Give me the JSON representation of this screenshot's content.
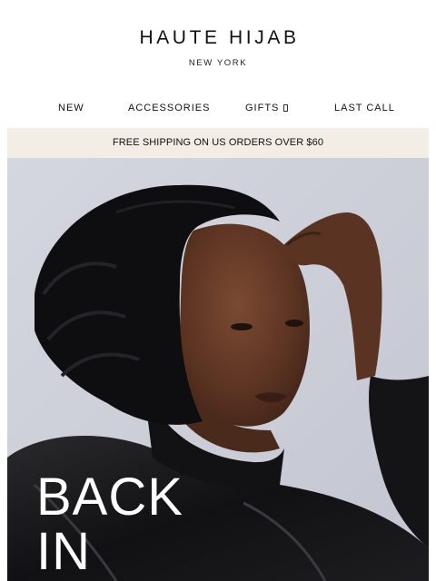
{
  "brand": {
    "name": "HAUTE HIJAB",
    "location": "NEW YORK"
  },
  "nav": {
    "items": [
      {
        "label": "NEW"
      },
      {
        "label": "ACCESSORIES"
      },
      {
        "label": "GIFTS"
      },
      {
        "label": "LAST CALL"
      }
    ],
    "gifts_icon": "dropdown-icon"
  },
  "banner": {
    "text": "FREE SHIPPING ON US ORDERS OVER $60"
  },
  "hero": {
    "headline_line1": "BACK",
    "headline_line2": "IN",
    "background_color": "#c9ccd6"
  }
}
